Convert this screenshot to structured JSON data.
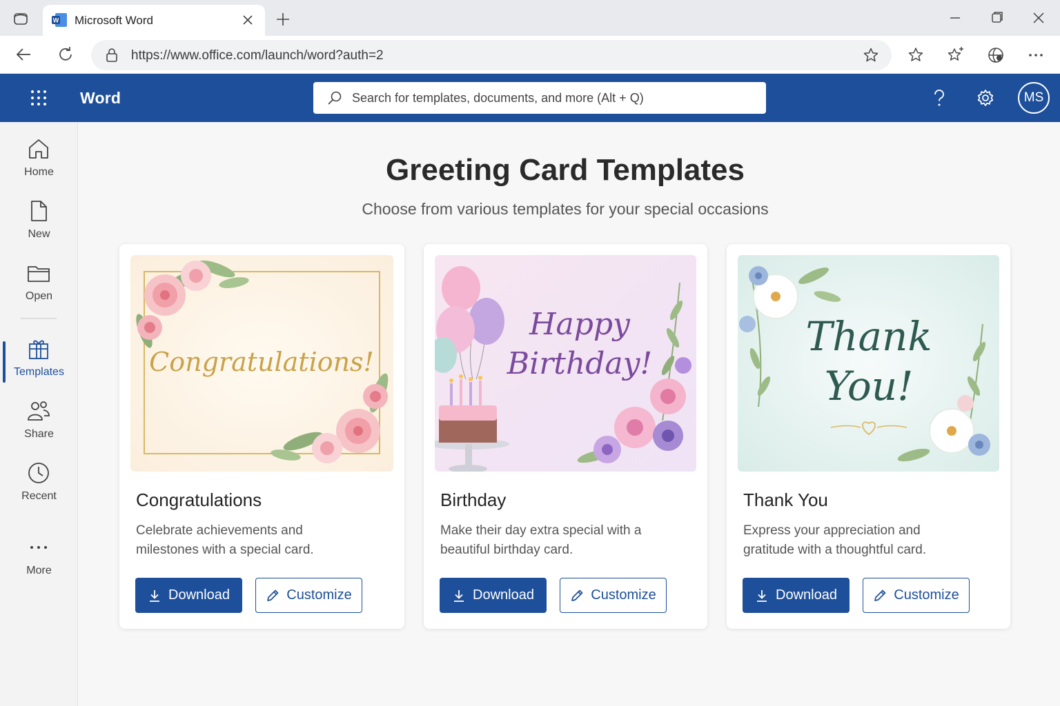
{
  "browser": {
    "tab_title": "Microsoft Word",
    "url": "https://www.office.com/launch/word?auth=2"
  },
  "app": {
    "name": "Word",
    "search_placeholder": "Search for templates, documents, and more (Alt + Q)",
    "avatar_initials": "MS"
  },
  "sidebar": {
    "items": [
      {
        "label": "Home"
      },
      {
        "label": "New"
      },
      {
        "label": "Open"
      },
      {
        "label": "Templates"
      },
      {
        "label": "Share"
      },
      {
        "label": "Recent"
      },
      {
        "label": "More"
      }
    ],
    "active": "Templates"
  },
  "main": {
    "title": "Greeting Card Templates",
    "subtitle": "Choose from various templates for your special occasions",
    "cards": [
      {
        "title": "Congratulations",
        "description": "Celebrate achievements and milestones with a special card.",
        "art_text": "Congratulations!",
        "download_label": "Download",
        "customize_label": "Customize"
      },
      {
        "title": "Birthday",
        "description": "Make their day extra special with a beautiful birthday card.",
        "art_text_1": "Happy",
        "art_text_2": "Birthday!",
        "download_label": "Download",
        "customize_label": "Customize"
      },
      {
        "title": "Thank You",
        "description": "Express your appreciation and gratitude with a thoughtful card.",
        "art_text_1": "Thank",
        "art_text_2": "You!",
        "download_label": "Download",
        "customize_label": "Customize"
      }
    ]
  },
  "colors": {
    "brand": "#1d4f9a",
    "congrats_gold": "#c9a24a",
    "birthday_purple": "#7a4a9c",
    "thankyou_teal": "#2f5a50"
  },
  "icons": [
    "window-icon",
    "word-logo-icon",
    "close-icon",
    "plus-icon",
    "minimize-icon",
    "maximize-icon",
    "back-icon",
    "refresh-icon",
    "lock-icon",
    "star-icon",
    "extensions-icon",
    "favorites-icon",
    "copilot-icon",
    "more-icon",
    "waffle-icon",
    "search-icon",
    "help-icon",
    "gear-icon",
    "home-icon",
    "new-doc-icon",
    "folder-icon",
    "templates-icon",
    "share-icon",
    "recent-icon",
    "more-dots-icon",
    "download-icon",
    "pencil-icon"
  ]
}
